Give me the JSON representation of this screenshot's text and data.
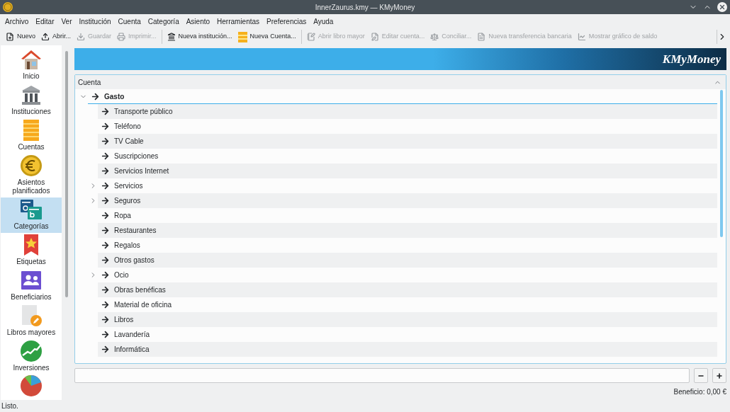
{
  "window": {
    "title": "InnerZaurus.kmy — KMyMoney"
  },
  "menu": [
    "Archivo",
    "Editar",
    "Ver",
    "Institución",
    "Cuenta",
    "Categoría",
    "Asiento",
    "Herramientas",
    "Preferencias",
    "Ayuda"
  ],
  "toolbar": [
    {
      "kind": "new",
      "label": "Nuevo",
      "disabled": false
    },
    {
      "kind": "open",
      "label": "Abrir...",
      "disabled": false
    },
    {
      "kind": "save",
      "label": "Guardar",
      "disabled": true
    },
    {
      "kind": "print",
      "label": "Imprimir...",
      "disabled": true
    },
    {
      "kind": "institution",
      "label": "Nueva institución...",
      "disabled": false
    },
    {
      "kind": "account",
      "label": "Nueva Cuenta...",
      "disabled": false
    },
    {
      "kind": "ledger",
      "label": "Abrir libro mayor",
      "disabled": true
    },
    {
      "kind": "edit",
      "label": "Editar cuenta...",
      "disabled": true
    },
    {
      "kind": "reconcile",
      "label": "Conciliar...",
      "disabled": true
    },
    {
      "kind": "transfer",
      "label": "Nueva transferencia bancaria",
      "disabled": true
    },
    {
      "kind": "chart",
      "label": "Mostrar gráfico de saldo",
      "disabled": true
    }
  ],
  "sidebar": {
    "items": [
      {
        "kind": "home",
        "label": "Inicio",
        "selected": false
      },
      {
        "kind": "institutions",
        "label": "Instituciones",
        "selected": false
      },
      {
        "kind": "accounts",
        "label": "Cuentas",
        "selected": false
      },
      {
        "kind": "scheduled",
        "label": "Asientos planificados",
        "selected": false
      },
      {
        "kind": "categories",
        "label": "Categorías",
        "selected": true
      },
      {
        "kind": "tags",
        "label": "Etiquetas",
        "selected": false
      },
      {
        "kind": "payees",
        "label": "Beneficiarios",
        "selected": false
      },
      {
        "kind": "ledgers",
        "label": "Libros mayores",
        "selected": false
      },
      {
        "kind": "investments",
        "label": "Inversiones",
        "selected": false
      }
    ]
  },
  "banner": {
    "logo": "KMyMoney"
  },
  "tree": {
    "column": "Cuenta",
    "items": [
      {
        "label": "Gasto",
        "kind": "branch",
        "expanded": true,
        "children": [
          {
            "label": "Transporte público",
            "kind": "leaf"
          },
          {
            "label": "Teléfono",
            "kind": "leaf"
          },
          {
            "label": "TV Cable",
            "kind": "leaf"
          },
          {
            "label": "Suscripciones",
            "kind": "leaf"
          },
          {
            "label": "Servicios Internet",
            "kind": "leaf"
          },
          {
            "label": "Servicios",
            "kind": "branch",
            "expanded": false
          },
          {
            "label": "Seguros",
            "kind": "branch",
            "expanded": false
          },
          {
            "label": "Ropa",
            "kind": "leaf"
          },
          {
            "label": "Restaurantes",
            "kind": "leaf"
          },
          {
            "label": "Regalos",
            "kind": "leaf"
          },
          {
            "label": "Otros gastos",
            "kind": "leaf"
          },
          {
            "label": "Ocio",
            "kind": "branch",
            "expanded": false
          },
          {
            "label": "Obras benéficas",
            "kind": "leaf"
          },
          {
            "label": "Material de oficina",
            "kind": "leaf"
          },
          {
            "label": "Libros",
            "kind": "leaf"
          },
          {
            "label": "Lavandería",
            "kind": "leaf"
          },
          {
            "label": "Informática",
            "kind": "leaf"
          }
        ]
      }
    ]
  },
  "footer": {
    "profit": "Beneficio: 0,00 €"
  },
  "status_bar": "Listo."
}
